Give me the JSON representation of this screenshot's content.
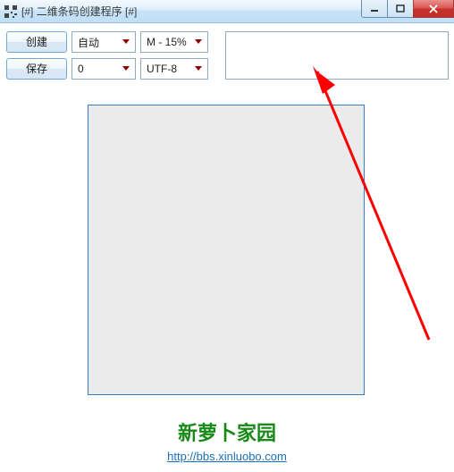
{
  "window": {
    "title": "[#] 二维条码创建程序 [#]"
  },
  "toolbar": {
    "create_label": "创建",
    "save_label": "保存",
    "mode_select": "自动",
    "ec_select": "M - 15%",
    "number_select": "0",
    "encoding_select": "UTF-8"
  },
  "input": {
    "text_value": ""
  },
  "footer": {
    "site_name": "新萝卜家园",
    "site_url": "http://bbs.xinluobo.com"
  }
}
